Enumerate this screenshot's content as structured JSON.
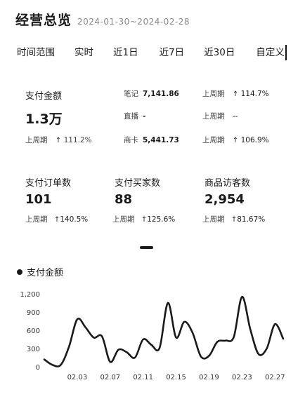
{
  "header": {
    "title": "经营总览",
    "date_range": "2024-01-30~2024-02-28"
  },
  "tabs": [
    {
      "label": "时间范围"
    },
    {
      "label": "实时"
    },
    {
      "label": "近1日"
    },
    {
      "label": "近7日"
    },
    {
      "label": "近30日"
    },
    {
      "label": "自定义"
    }
  ],
  "payment": {
    "label": "支付金额",
    "value": "1.3万",
    "cmp_label": "上周期",
    "cmp_value": "111.2%",
    "channels": [
      {
        "name": "笔记",
        "value": "7,141.86",
        "cmp_label": "上周期",
        "cmp_value": "114.7%"
      },
      {
        "name": "直播",
        "value": "-",
        "cmp_label": "上周期",
        "cmp_value": "--"
      },
      {
        "name": "商卡",
        "value": "5,441.73",
        "cmp_label": "上周期",
        "cmp_value": "106.9%"
      }
    ]
  },
  "metrics": [
    {
      "label": "支付订单数",
      "value": "101",
      "cmp_label": "上周期",
      "cmp_value": "140.5%"
    },
    {
      "label": "支付买家数",
      "value": "88",
      "cmp_label": "上周期",
      "cmp_value": "125.6%"
    },
    {
      "label": "商品访客数",
      "value": "2,954",
      "cmp_label": "上周期",
      "cmp_value": "81.67%"
    }
  ],
  "arrow_glyph": "↑",
  "chart_title": "支付金额",
  "chart_data": {
    "type": "line",
    "title": "支付金额",
    "xlabel": "",
    "ylabel": "",
    "ylim": [
      0,
      1200
    ],
    "yticks": [
      0,
      300,
      600,
      900,
      1200
    ],
    "ytick_labels": [
      "0",
      "300",
      "600",
      "900",
      "1,200"
    ],
    "x": [
      "01.30",
      "01.31",
      "02.01",
      "02.02",
      "02.03",
      "02.04",
      "02.05",
      "02.06",
      "02.07",
      "02.08",
      "02.09",
      "02.10",
      "02.11",
      "02.12",
      "02.13",
      "02.14",
      "02.15",
      "02.16",
      "02.17",
      "02.18",
      "02.19",
      "02.20",
      "02.21",
      "02.22",
      "02.23",
      "02.24",
      "02.25",
      "02.26",
      "02.27",
      "02.28"
    ],
    "xtick_labels": [
      "02.03",
      "02.07",
      "02.11",
      "02.15",
      "02.19",
      "02.23",
      "02.27"
    ],
    "series": [
      {
        "values": [
          120,
          30,
          30,
          330,
          780,
          650,
          480,
          500,
          80,
          280,
          240,
          150,
          450,
          360,
          310,
          1050,
          480,
          740,
          560,
          170,
          180,
          410,
          430,
          490,
          1150,
          620,
          210,
          300,
          700,
          460
        ]
      }
    ],
    "grid": false,
    "line_color": "#1a1a1a"
  }
}
